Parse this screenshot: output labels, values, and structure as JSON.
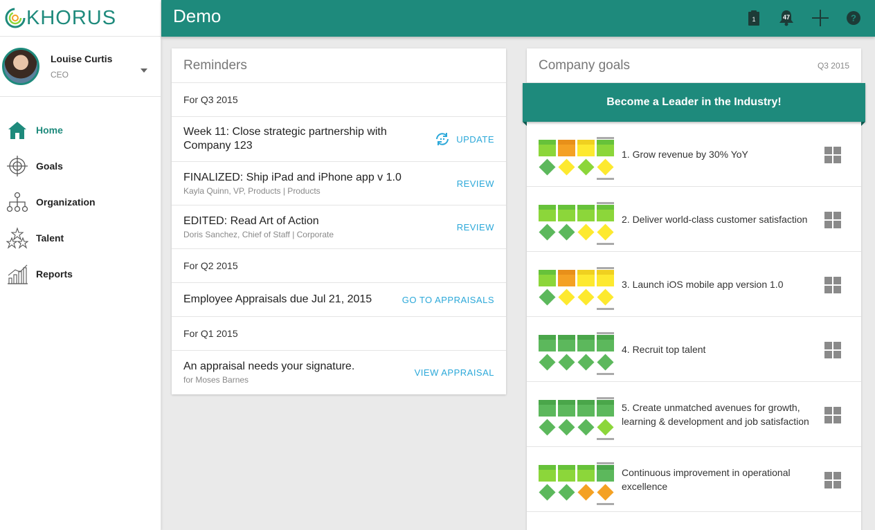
{
  "app": {
    "logo": "KHORUS",
    "page_title": "Demo"
  },
  "header": {
    "clipboard_badge": "1",
    "notifications_badge": "47"
  },
  "user": {
    "name": "Louise Curtis",
    "role": "CEO"
  },
  "nav": [
    {
      "label": "Home",
      "icon": "home-icon",
      "active": true
    },
    {
      "label": "Goals",
      "icon": "target-icon",
      "active": false
    },
    {
      "label": "Organization",
      "icon": "org-chart-icon",
      "active": false
    },
    {
      "label": "Talent",
      "icon": "stars-icon",
      "active": false
    },
    {
      "label": "Reports",
      "icon": "bar-chart-icon",
      "active": false
    }
  ],
  "colors": {
    "brand": "#1e8a7c",
    "link": "#2ba8d9",
    "green": "#8cd63a",
    "darkgreen": "#5cb85c",
    "yellow": "#fde92f",
    "orange": "#f4a124",
    "gray": "#aaaaaa"
  },
  "reminders": {
    "title": "Reminders",
    "items": [
      {
        "type": "section",
        "text": "For Q3 2015"
      },
      {
        "type": "item",
        "text": "Week 11: Close strategic partnership with Company 123",
        "meta": "",
        "action": "UPDATE"
      },
      {
        "type": "item",
        "text": "FINALIZED: Ship iPad and iPhone app v 1.0",
        "meta": "Kayla Quinn, VP, Products | Products",
        "action": "REVIEW"
      },
      {
        "type": "item",
        "text": "EDITED: Read Art of Action",
        "meta": "Doris Sanchez, Chief of Staff | Corporate",
        "action": "REVIEW"
      },
      {
        "type": "section",
        "text": "For Q2 2015"
      },
      {
        "type": "item",
        "text": "Employee Appraisals due Jul 21, 2015",
        "meta": "",
        "action": "GO TO APPRAISALS"
      },
      {
        "type": "section",
        "text": "For Q1 2015"
      },
      {
        "type": "item",
        "text": "An appraisal needs your signature.",
        "meta": "for Moses Barnes",
        "action": "VIEW APPRAISAL"
      }
    ]
  },
  "goals": {
    "title": "Company goals",
    "period": "Q3 2015",
    "banner": "Become a Leader in the Industry!",
    "items": [
      {
        "text": "1. Grow revenue by 30% YoY",
        "bars": [
          "green",
          "orange",
          "yellow",
          "green"
        ],
        "diamonds": [
          "darkgreen",
          "yellow",
          "green",
          "yellow"
        ]
      },
      {
        "text": "2. Deliver world-class customer satisfaction",
        "bars": [
          "green",
          "green",
          "green",
          "green"
        ],
        "diamonds": [
          "darkgreen",
          "darkgreen",
          "yellow",
          "yellow"
        ]
      },
      {
        "text": "3. Launch iOS mobile app version 1.0",
        "bars": [
          "green",
          "orange",
          "yellow",
          "yellow"
        ],
        "diamonds": [
          "darkgreen",
          "yellow",
          "yellow",
          "yellow"
        ]
      },
      {
        "text": "4. Recruit top talent",
        "bars": [
          "darkgreen",
          "darkgreen",
          "darkgreen",
          "darkgreen"
        ],
        "diamonds": [
          "darkgreen",
          "darkgreen",
          "darkgreen",
          "darkgreen"
        ]
      },
      {
        "text": "5. Create unmatched avenues for growth, learning & development and job satisfaction",
        "bars": [
          "darkgreen",
          "darkgreen",
          "darkgreen",
          "darkgreen"
        ],
        "diamonds": [
          "darkgreen",
          "darkgreen",
          "darkgreen",
          "green"
        ]
      },
      {
        "text": "Continuous improvement in operational excellence",
        "bars": [
          "green",
          "green",
          "green",
          "darkgreen"
        ],
        "diamonds": [
          "darkgreen",
          "darkgreen",
          "orange",
          "orange"
        ]
      }
    ]
  }
}
